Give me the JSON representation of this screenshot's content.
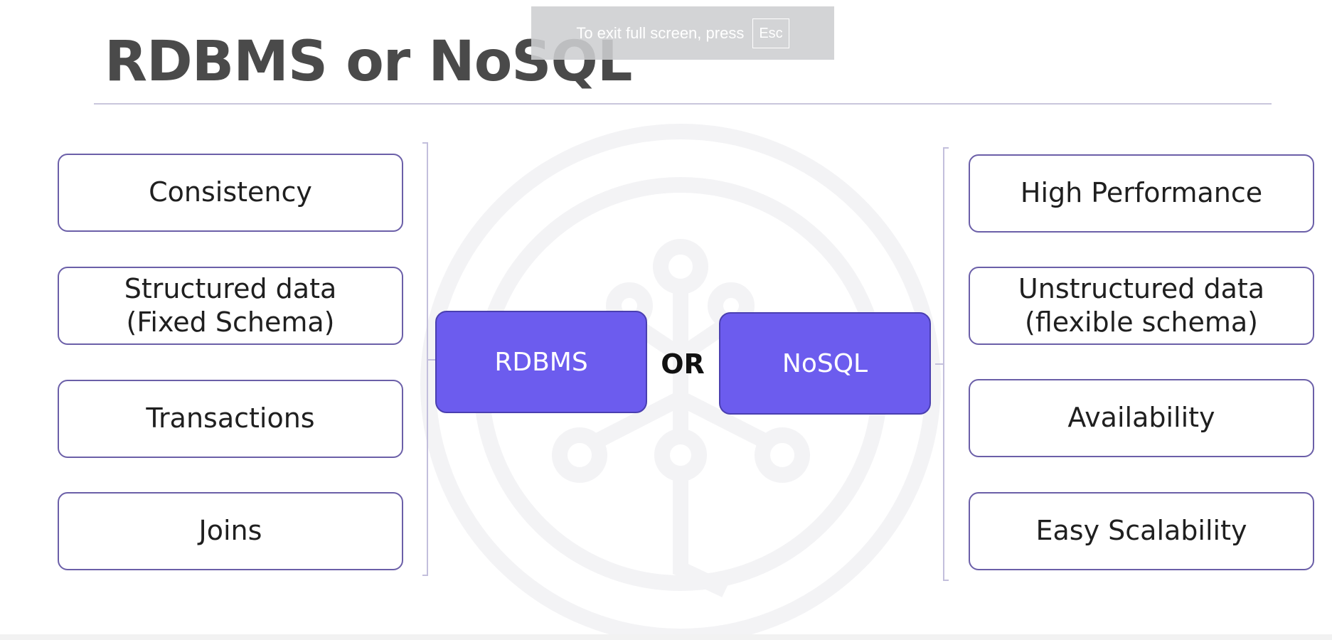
{
  "slide": {
    "title": "RDBMS or NoSQL",
    "connector": "OR",
    "rdbms_label": "RDBMS",
    "nosql_label": "NoSQL",
    "rdbms_traits": [
      {
        "label": "Consistency"
      },
      {
        "label": "Structured data\n(Fixed Schema)"
      },
      {
        "label": "Transactions"
      },
      {
        "label": "Joins"
      }
    ],
    "nosql_traits": [
      {
        "label": "High Performance"
      },
      {
        "label": "Unstructured data\n(flexible schema)"
      },
      {
        "label": "Availability"
      },
      {
        "label": "Easy Scalability"
      }
    ]
  },
  "fullscreen_notice": {
    "message": "To exit full screen, press",
    "key": "Esc"
  },
  "colors": {
    "accent": "#6c5cee",
    "box_border": "#6b5fa8",
    "title_text": "#4a4a4a"
  },
  "icons": {
    "watermark": "network-logo-watermark"
  }
}
